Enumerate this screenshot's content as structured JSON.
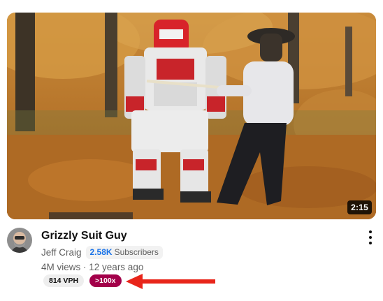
{
  "video": {
    "duration": "2:15",
    "title": "Grizzly Suit Guy",
    "channel": "Jeff Craig",
    "subscriber_count": "2.58K",
    "subscriber_label": "Subscribers",
    "views": "4M views",
    "age": "12 years ago",
    "vph": "814 VPH",
    "outlier": ">100x"
  },
  "colors": {
    "subscriber_count": "#1a73e8",
    "outlier_badge": "#a3004a",
    "annotation_arrow": "#e8251a"
  },
  "icons": {
    "menu": "more-vert-icon",
    "annotation": "red-arrow-icon"
  }
}
